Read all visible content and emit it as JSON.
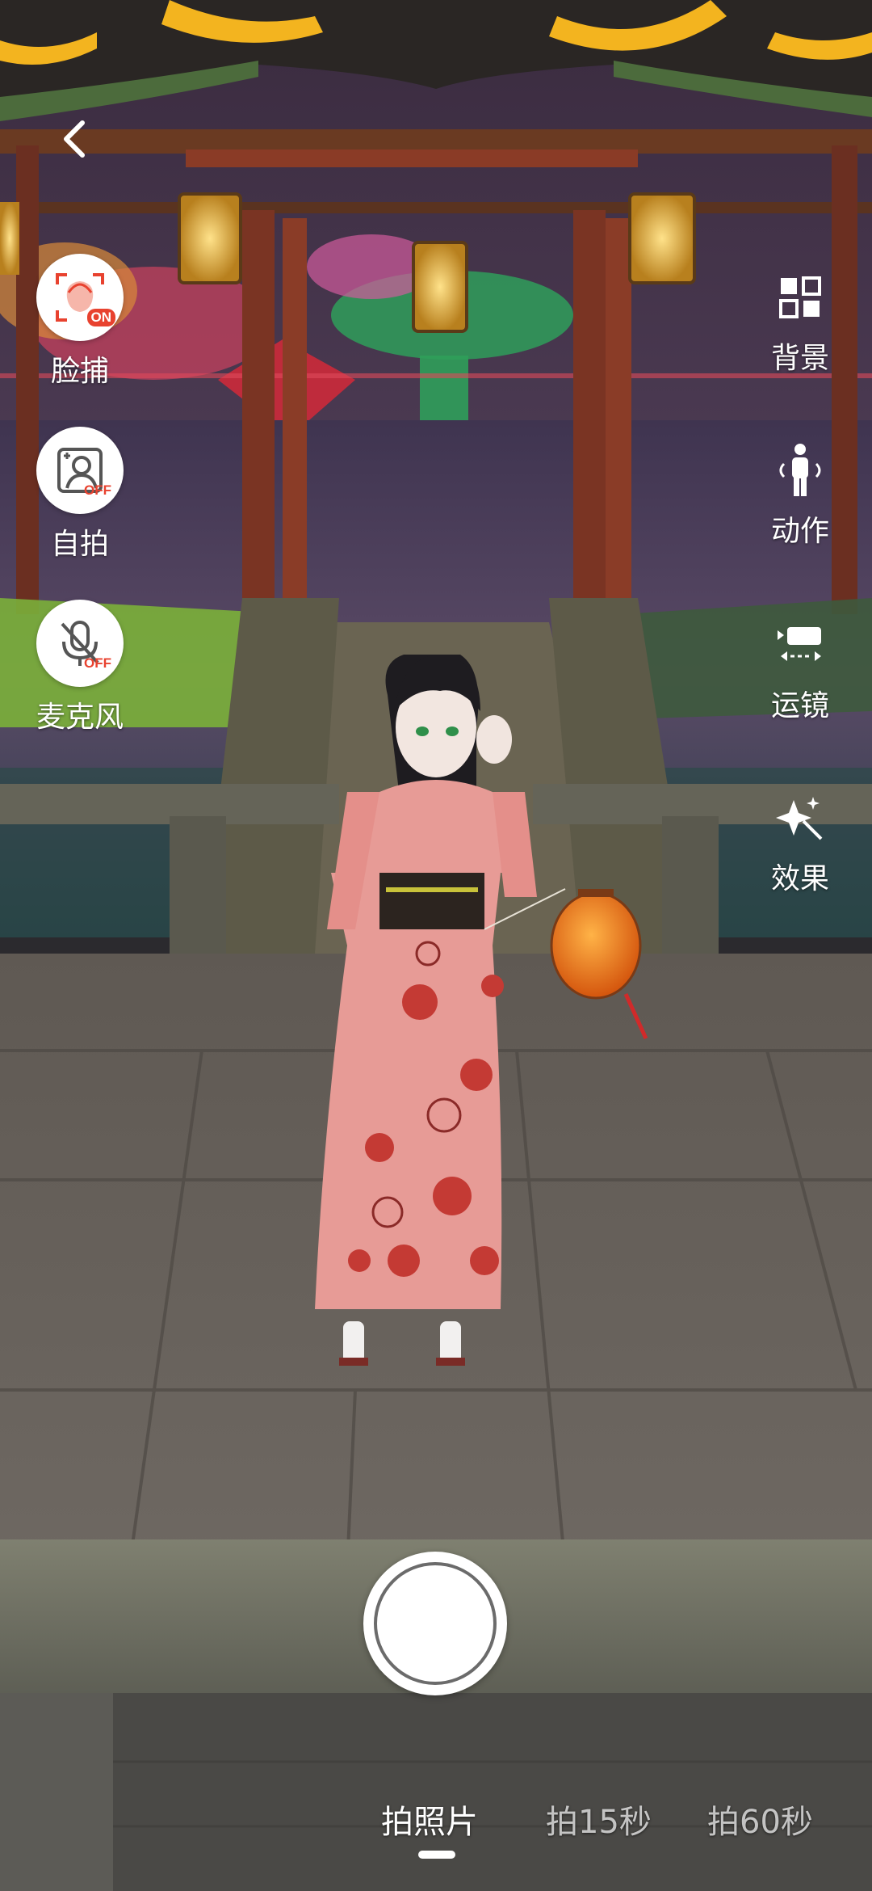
{
  "nav": {
    "back_icon": "chevron-left-icon"
  },
  "left_tools": [
    {
      "label": "脸捕",
      "icon": "face-capture-icon",
      "state": "ON"
    },
    {
      "label": "自拍",
      "icon": "selfie-icon",
      "state": "OFF"
    },
    {
      "label": "麦克风",
      "icon": "microphone-icon",
      "state": "OFF"
    }
  ],
  "right_tools": [
    {
      "label": "背景",
      "icon": "background-icon"
    },
    {
      "label": "动作",
      "icon": "action-figure-icon"
    },
    {
      "label": "运镜",
      "icon": "camera-movement-icon"
    },
    {
      "label": "效果",
      "icon": "effects-sparkle-icon"
    }
  ],
  "capture": {
    "shutter_icon": "shutter-icon",
    "modes": [
      "拍照片",
      "拍15秒",
      "拍60秒"
    ],
    "active_mode": "拍照片"
  },
  "colors": {
    "accent_red": "#e8422f",
    "overlay_text": "#ffffff"
  }
}
